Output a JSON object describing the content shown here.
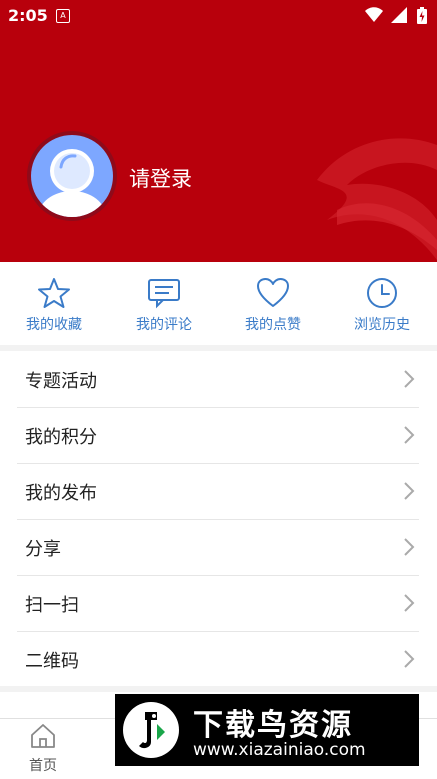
{
  "status": {
    "time": "2:05",
    "notif_icon": "A"
  },
  "profile": {
    "login_text": "请登录"
  },
  "quick_actions": [
    {
      "label": "我的收藏",
      "icon": "star-icon"
    },
    {
      "label": "我的评论",
      "icon": "comment-icon"
    },
    {
      "label": "我的点赞",
      "icon": "heart-icon"
    },
    {
      "label": "浏览历史",
      "icon": "clock-icon"
    }
  ],
  "menu": [
    {
      "label": "专题活动"
    },
    {
      "label": "我的积分"
    },
    {
      "label": "我的发布"
    },
    {
      "label": "分享"
    },
    {
      "label": "扫一扫"
    },
    {
      "label": "二维码"
    }
  ],
  "tabbar": {
    "home_label": "首页"
  },
  "watermark": {
    "title": "下载鸟资源",
    "url": "www.xiazainiao.com"
  },
  "colors": {
    "brand_red": "#b8000c",
    "accent_blue": "#3a7bc8"
  }
}
